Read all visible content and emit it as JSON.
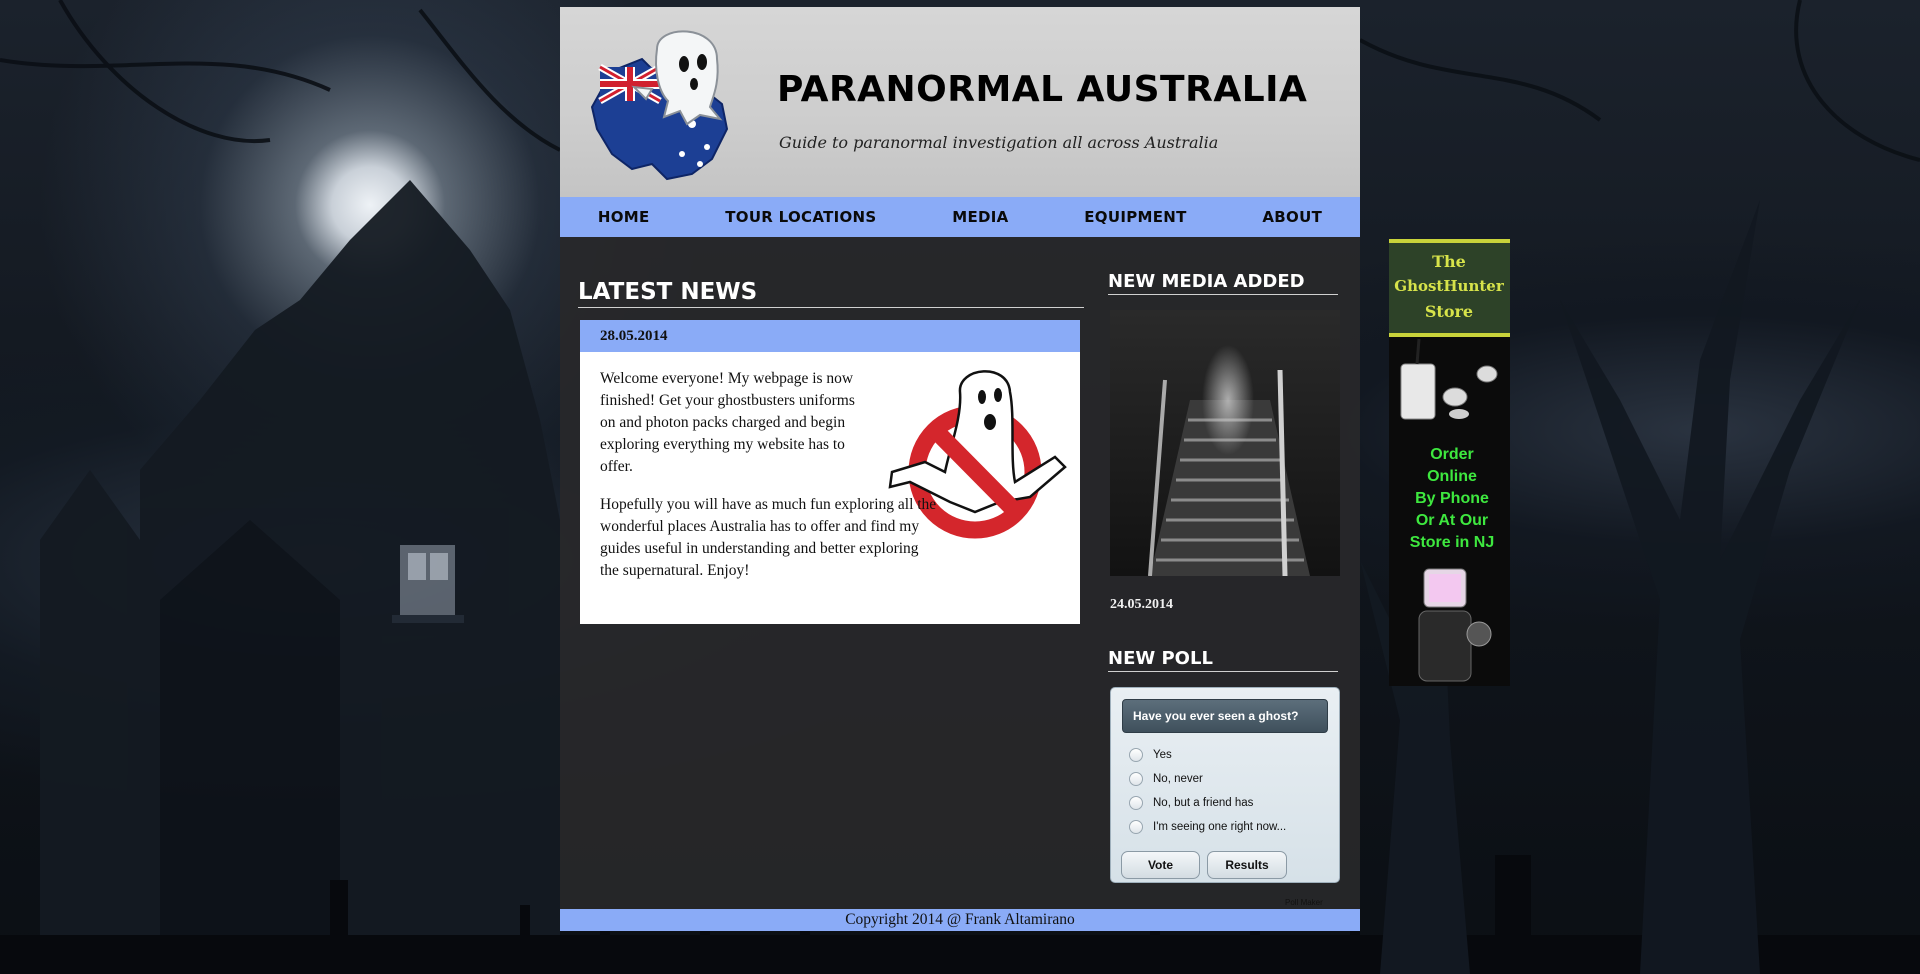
{
  "header": {
    "site_title": "PARANORMAL AUSTRALIA",
    "tagline": "Guide to paranormal investigation all across Australia"
  },
  "nav": {
    "items": [
      {
        "label": "HOME"
      },
      {
        "label": "TOUR LOCATIONS"
      },
      {
        "label": "MEDIA"
      },
      {
        "label": "EQUIPMENT"
      },
      {
        "label": "ABOUT"
      }
    ]
  },
  "latest_news": {
    "title": "LATEST NEWS",
    "date": "28.05.2014",
    "paragraphs": [
      "Welcome everyone! My webpage is now finished! Get your ghostbusters uniforms on and photon packs charged and begin exploring everything my website has to offer.",
      "Hopefully you will have as much fun exploring all the wonderful places Australia has to offer and find my guides useful in understanding and better exploring the supernatural. Enjoy!"
    ]
  },
  "new_media": {
    "title": "NEW MEDIA ADDED",
    "date": "24.05.2014"
  },
  "poll": {
    "title": "NEW POLL",
    "question": "Have you ever seen a ghost?",
    "options": [
      "Yes",
      "No, never",
      "No, but a friend has",
      "I'm seeing one right now..."
    ],
    "vote_label": "Vote",
    "results_label": "Results",
    "maker_label": "Poll Maker"
  },
  "footer": {
    "copyright": "Copyright 2014 @ Frank Altamirano"
  },
  "ad": {
    "store_name": "The GhostHunter Store",
    "tagline": "Order Online By Phone Or At Our Store in NJ"
  },
  "colors": {
    "nav_blue": "#8aabf7",
    "header_gray": "#cdcdcd",
    "content_dark": "#28282a",
    "ad_green": "#39e03a"
  },
  "icons": [
    "australia-ghost-logo",
    "ghostbusters-logo",
    "security-camera-icon",
    "camcorder-icon"
  ]
}
